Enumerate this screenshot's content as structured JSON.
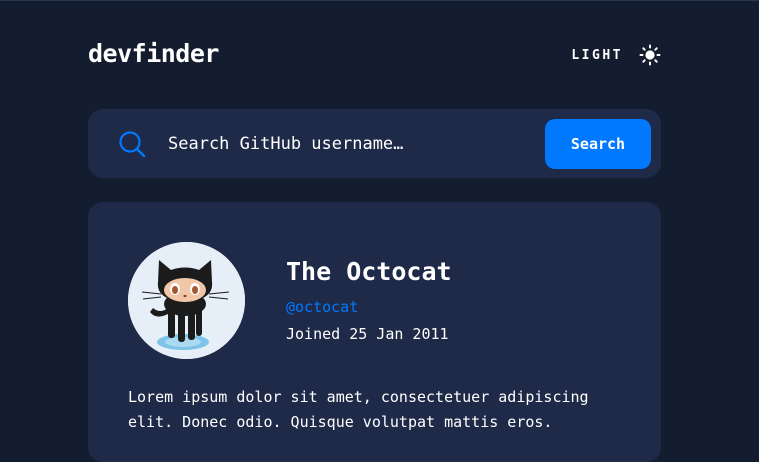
{
  "header": {
    "logo": "devfinder",
    "theme_label": "LIGHT",
    "theme_icon": "sun-icon"
  },
  "search": {
    "placeholder": "Search GitHub username…",
    "value": "",
    "button_label": "Search",
    "icon": "search-icon"
  },
  "profile": {
    "name": "The Octocat",
    "login": "@octocat",
    "joined": "Joined 25 Jan 2011",
    "bio": "Lorem ipsum dolor sit amet, consectetuer adipiscing elit. Donec odio. Quisque volutpat mattis eros.",
    "avatar_icon": "octocat-avatar"
  },
  "colors": {
    "background": "#141D2F",
    "card": "#1E2A47",
    "accent": "#0079FF",
    "text": "#FFFFFF"
  }
}
